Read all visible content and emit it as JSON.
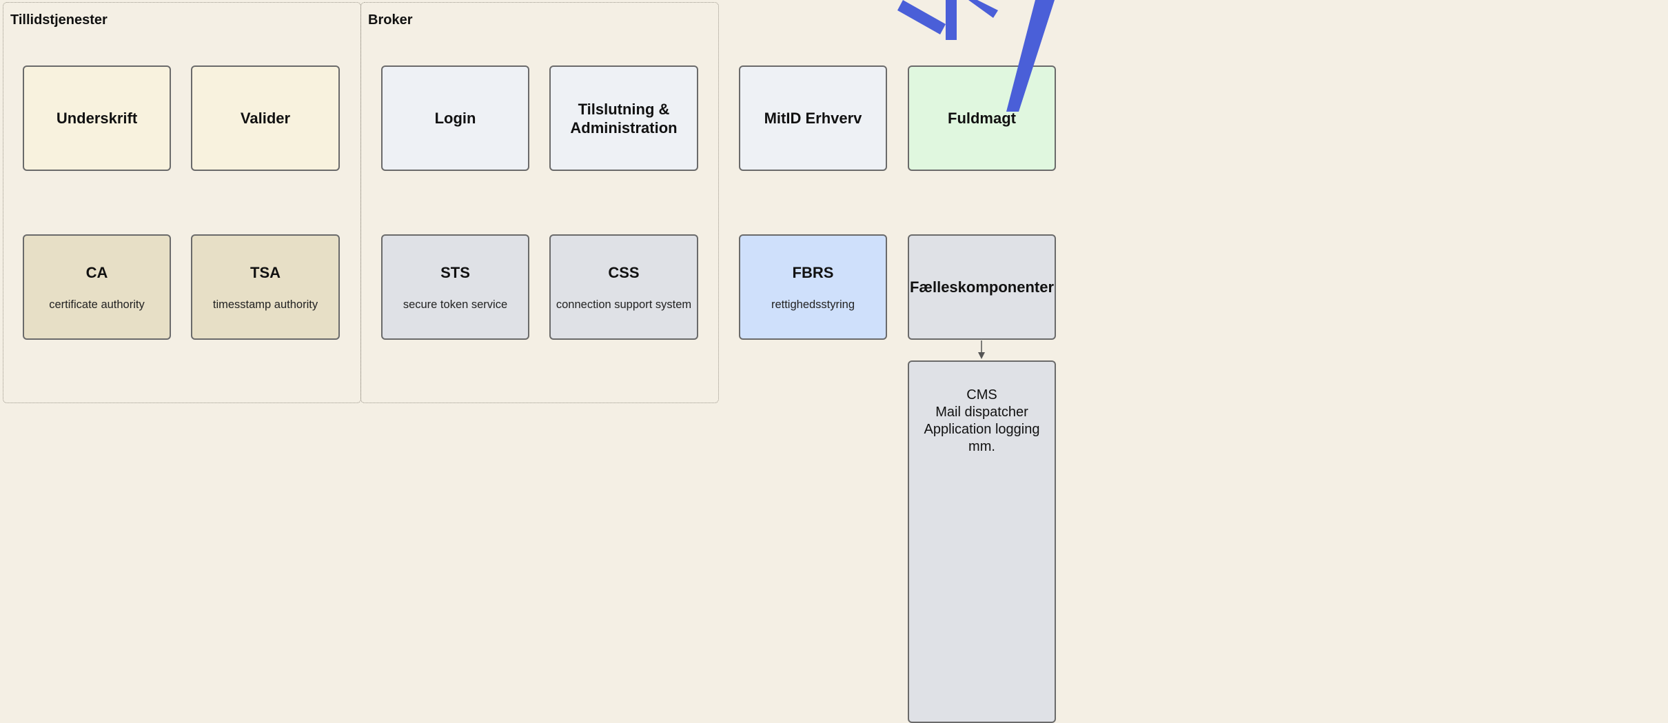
{
  "groups": {
    "tillid": "Tillidstjenester",
    "broker": "Broker"
  },
  "boxes": {
    "underskrift": {
      "title": "Underskrift"
    },
    "valider": {
      "title": "Valider"
    },
    "login": {
      "title": "Login"
    },
    "tilslutning": {
      "title": "Tilslutning &\nAdministration"
    },
    "mitid": {
      "title": "MitID Erhverv"
    },
    "fuldmagt": {
      "title": "Fuldmagt"
    },
    "ca": {
      "title": "CA",
      "sub": "certificate authority"
    },
    "tsa": {
      "title": "TSA",
      "sub": "timesstamp authority"
    },
    "sts": {
      "title": "STS",
      "sub": "secure token service"
    },
    "css": {
      "title": "CSS",
      "sub": "connection support system"
    },
    "fbrs": {
      "title": "FBRS",
      "sub": "rettighedsstyring"
    },
    "faelles": {
      "title": "Fælleskomponenter"
    },
    "cms": {
      "text": "CMS\nMail dispatcher\nApplication logging\nmm."
    }
  },
  "colors": {
    "background": "#f4efe4",
    "cream": "#f8f2de",
    "tan": "#e7dfc6",
    "light": "#eef1f5",
    "grey": "#dfe1e6",
    "blue": "#cfe0fb",
    "green": "#e0f7df",
    "overlay_stroke": "#4a5fd8"
  }
}
